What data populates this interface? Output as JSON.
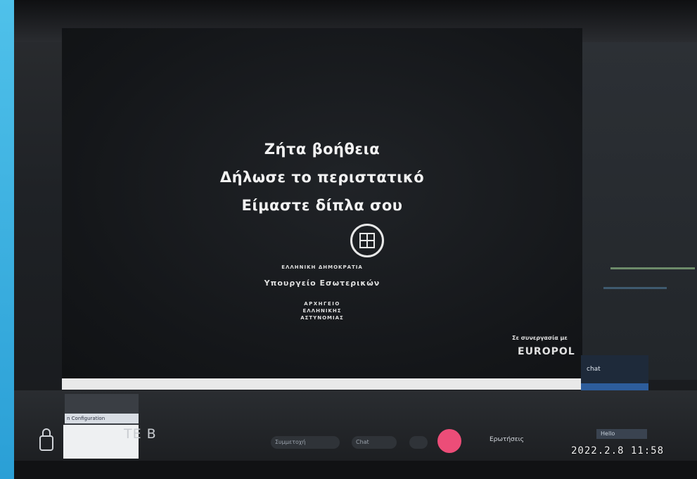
{
  "screen": {
    "message_lines": [
      "Ζήτα βοήθεια",
      "Δήλωσε το περιστατικό",
      "Είμαστε δίπλα σου"
    ],
    "republic": "ΕΛΛΗΝΙΚΗ ΔΗΜΟΚΡΑΤΙΑ",
    "ministry": "Υπουργείο Εσωτερικών",
    "police": [
      "ΑΡΧΗΓΕΙΟ",
      "ΕΛΛΗΝΙΚΗΣ",
      "ΑΣΤΥΝΟΜΙΑΣ"
    ],
    "partner_caption": "Σε συνεργασία με",
    "partner_logo": "EUROPOL"
  },
  "right_panel": {
    "label": "chat"
  },
  "taskbar": {
    "remote_label": "TE B",
    "thumbnail_label": "n Configuration",
    "pill1": "Συμμετοχή",
    "pill2": "Chat",
    "ask_label": "Ερωτήσεις",
    "mini_field": "Hello"
  },
  "timestamp": "2022.2.8  11:58",
  "colors": {
    "accent_blue": "#2a9fd6",
    "record_pink": "#ec4d78",
    "progress": "#e9e9e9"
  }
}
